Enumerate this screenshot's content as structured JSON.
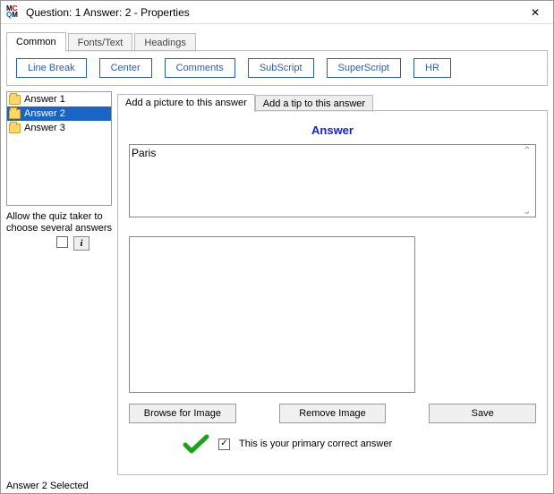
{
  "window": {
    "title": "Question:  1  Answer: 2 - Properties"
  },
  "tabs": {
    "items": [
      "Common",
      "Fonts/Text",
      "Headings"
    ],
    "active": 0
  },
  "toolbar": {
    "buttons": [
      "Line Break",
      "Center",
      "Comments",
      "SubScript",
      "SuperScript",
      "HR"
    ]
  },
  "sidebar": {
    "items": [
      "Answer 1",
      "Answer 2",
      "Answer 3"
    ],
    "selected": 1,
    "allow_label": "Allow the quiz taker to choose several answers",
    "allow_checked": false
  },
  "subtabs": {
    "items": [
      "Add a picture to this answer",
      "Add a tip to this answer"
    ],
    "active": 0
  },
  "panel": {
    "heading": "Answer",
    "answer_text": "Paris",
    "buttons": {
      "browse": "Browse for Image",
      "remove": "Remove Image",
      "save": "Save"
    },
    "primary_label": "This is your primary correct answer",
    "primary_checked": true
  },
  "status": "Answer 2 Selected",
  "icons": {
    "close": "✕",
    "info": "i",
    "check_big": "✔",
    "check_small": "✓",
    "up": "⌃",
    "down": "⌄"
  }
}
